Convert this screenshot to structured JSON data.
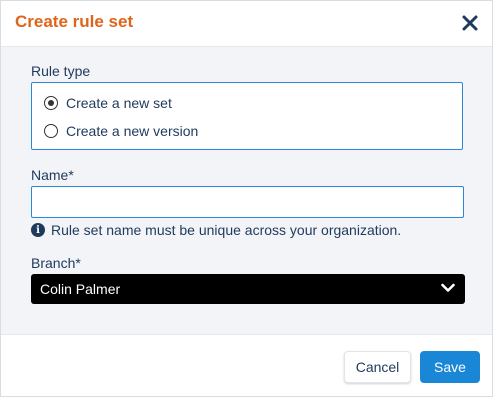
{
  "dialog": {
    "title": "Create rule set",
    "close_icon": "close-icon"
  },
  "rule_type": {
    "label": "Rule type",
    "options": [
      {
        "label": "Create a new set",
        "checked": true
      },
      {
        "label": "Create a new version",
        "checked": false
      }
    ]
  },
  "name_field": {
    "label": "Name*",
    "value": "",
    "placeholder": "",
    "hint": "Rule set name must be unique across your organization.",
    "hint_icon": "info-icon"
  },
  "branch_field": {
    "label": "Branch*",
    "selected": "Colin Palmer",
    "icon": "chevron-down-icon"
  },
  "footer": {
    "cancel_label": "Cancel",
    "save_label": "Save"
  },
  "colors": {
    "title": "#e0641a",
    "accent": "#1a86d6",
    "text": "#1e3a5c",
    "body_bg": "#f2f4f7"
  }
}
